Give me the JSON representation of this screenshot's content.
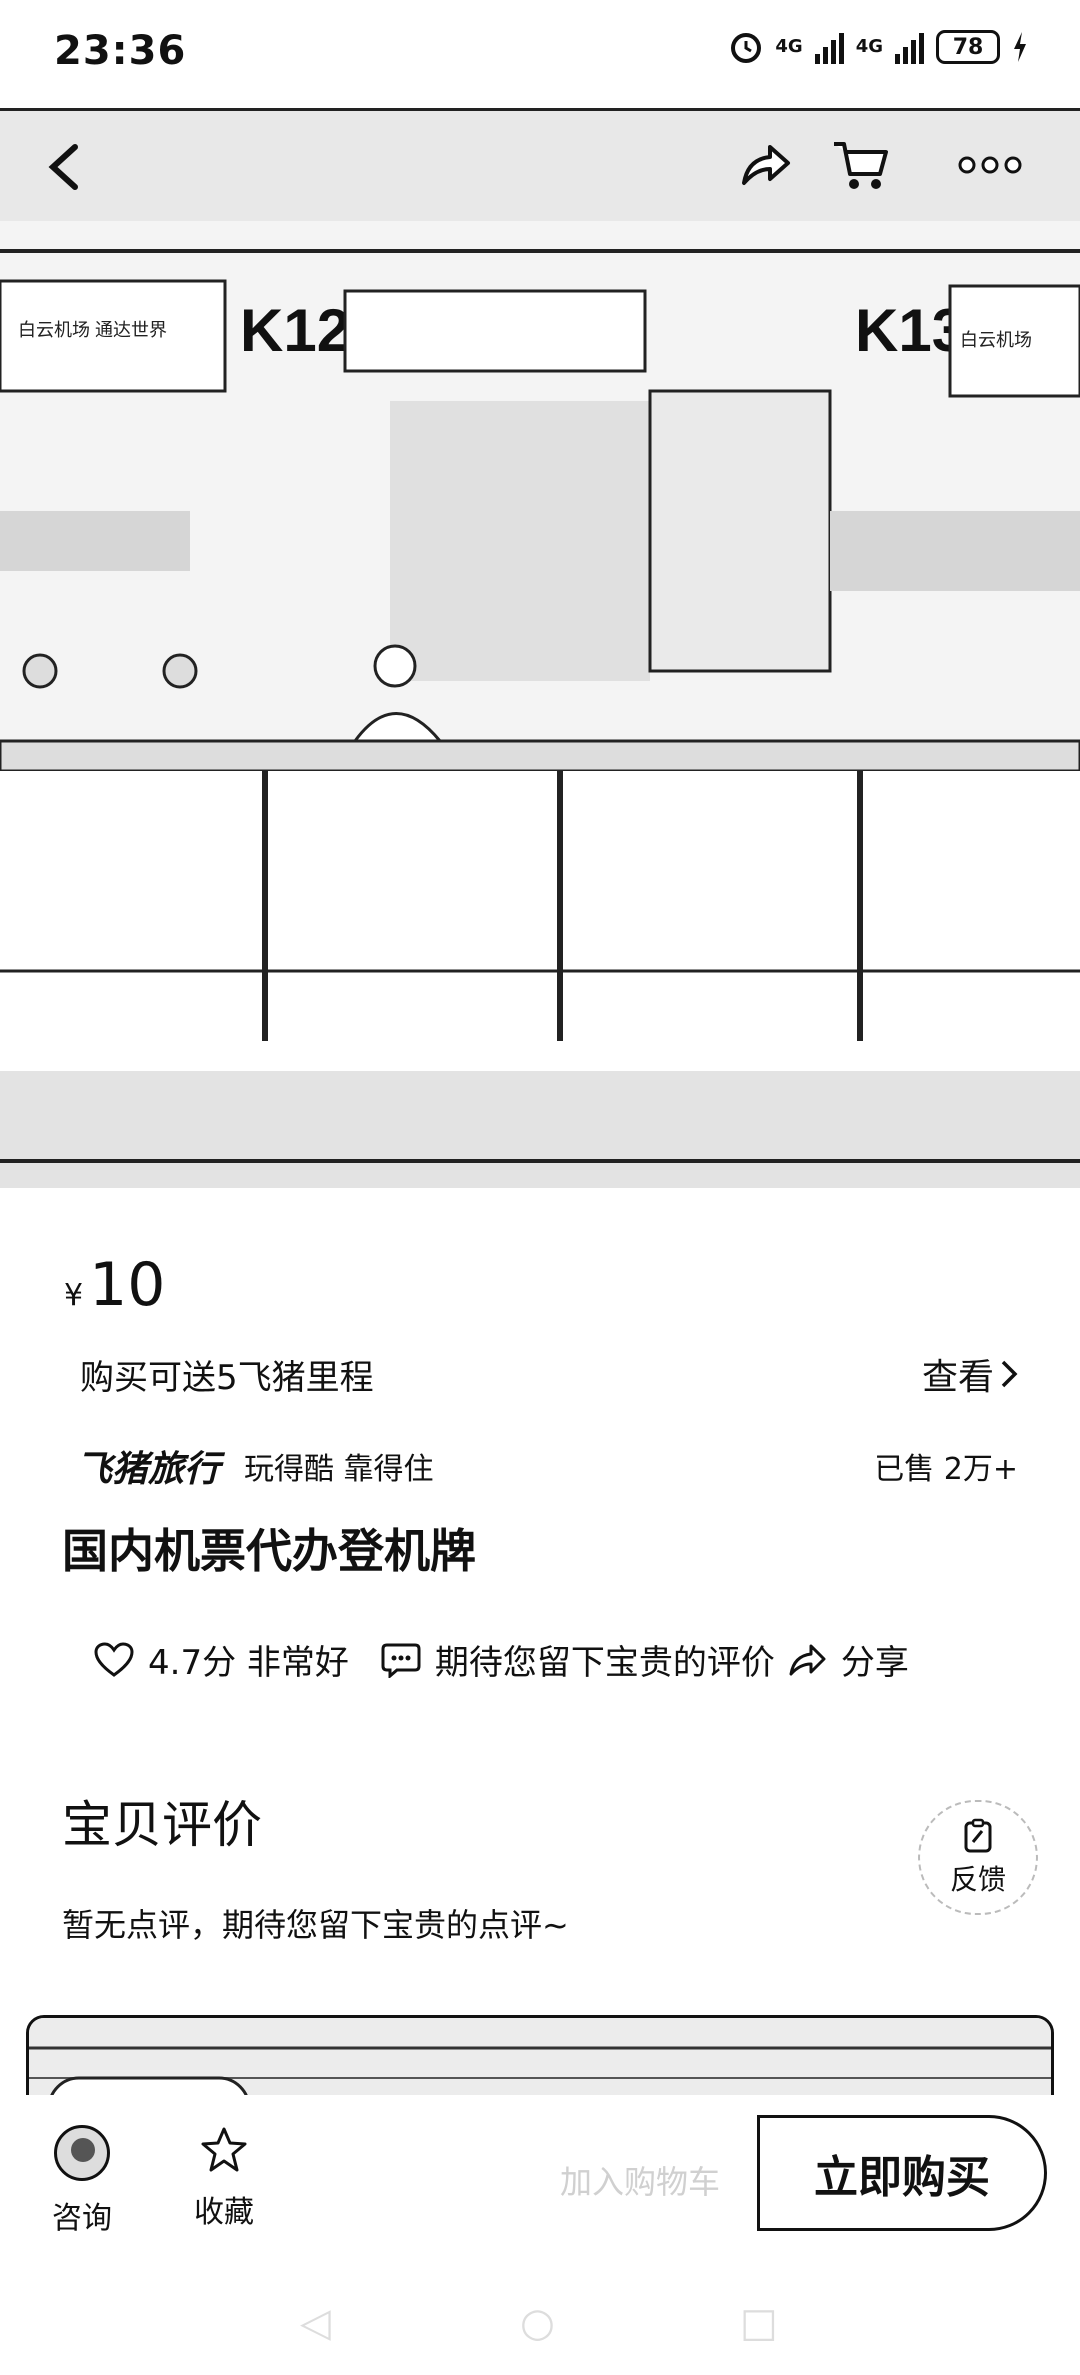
{
  "status_bar": {
    "time": "23:36",
    "network_1": "4G",
    "network_2": "4G",
    "battery": "78"
  },
  "nav": {
    "back_icon": "chevron-left-icon",
    "share_icon": "share-icon",
    "cart_icon": "cart-icon",
    "more_icon": "more-dots-icon"
  },
  "hero": {
    "counter_left": "K12",
    "counter_right": "K13",
    "sign_left": "白云机场 通达世界",
    "sign_right": "白云机场"
  },
  "product": {
    "currency": "¥",
    "price": "10",
    "miles_text": "购买可送5飞猪里程",
    "view_label": "查看",
    "brand_logo": "飞猪旅行",
    "brand_slogan": "玩得酷 靠得住",
    "sold": "已售 2万+",
    "title": "国内机票代办登机牌"
  },
  "stats": {
    "rating": "4.7分 非常好",
    "comment_prompt": "期待您留下宝贵的评价",
    "share_label": "分享"
  },
  "reviews": {
    "title": "宝贝评价",
    "empty_text": "暂无点评，期待您留下宝贵的点评~",
    "feedback_label": "反馈"
  },
  "bottom_bar": {
    "consult_label": "咨询",
    "favorite_label": "收藏",
    "faint_text": "加入购物车",
    "buy_label": "立即购买"
  },
  "colors": {
    "text": "#111111",
    "background": "#ffffff"
  }
}
